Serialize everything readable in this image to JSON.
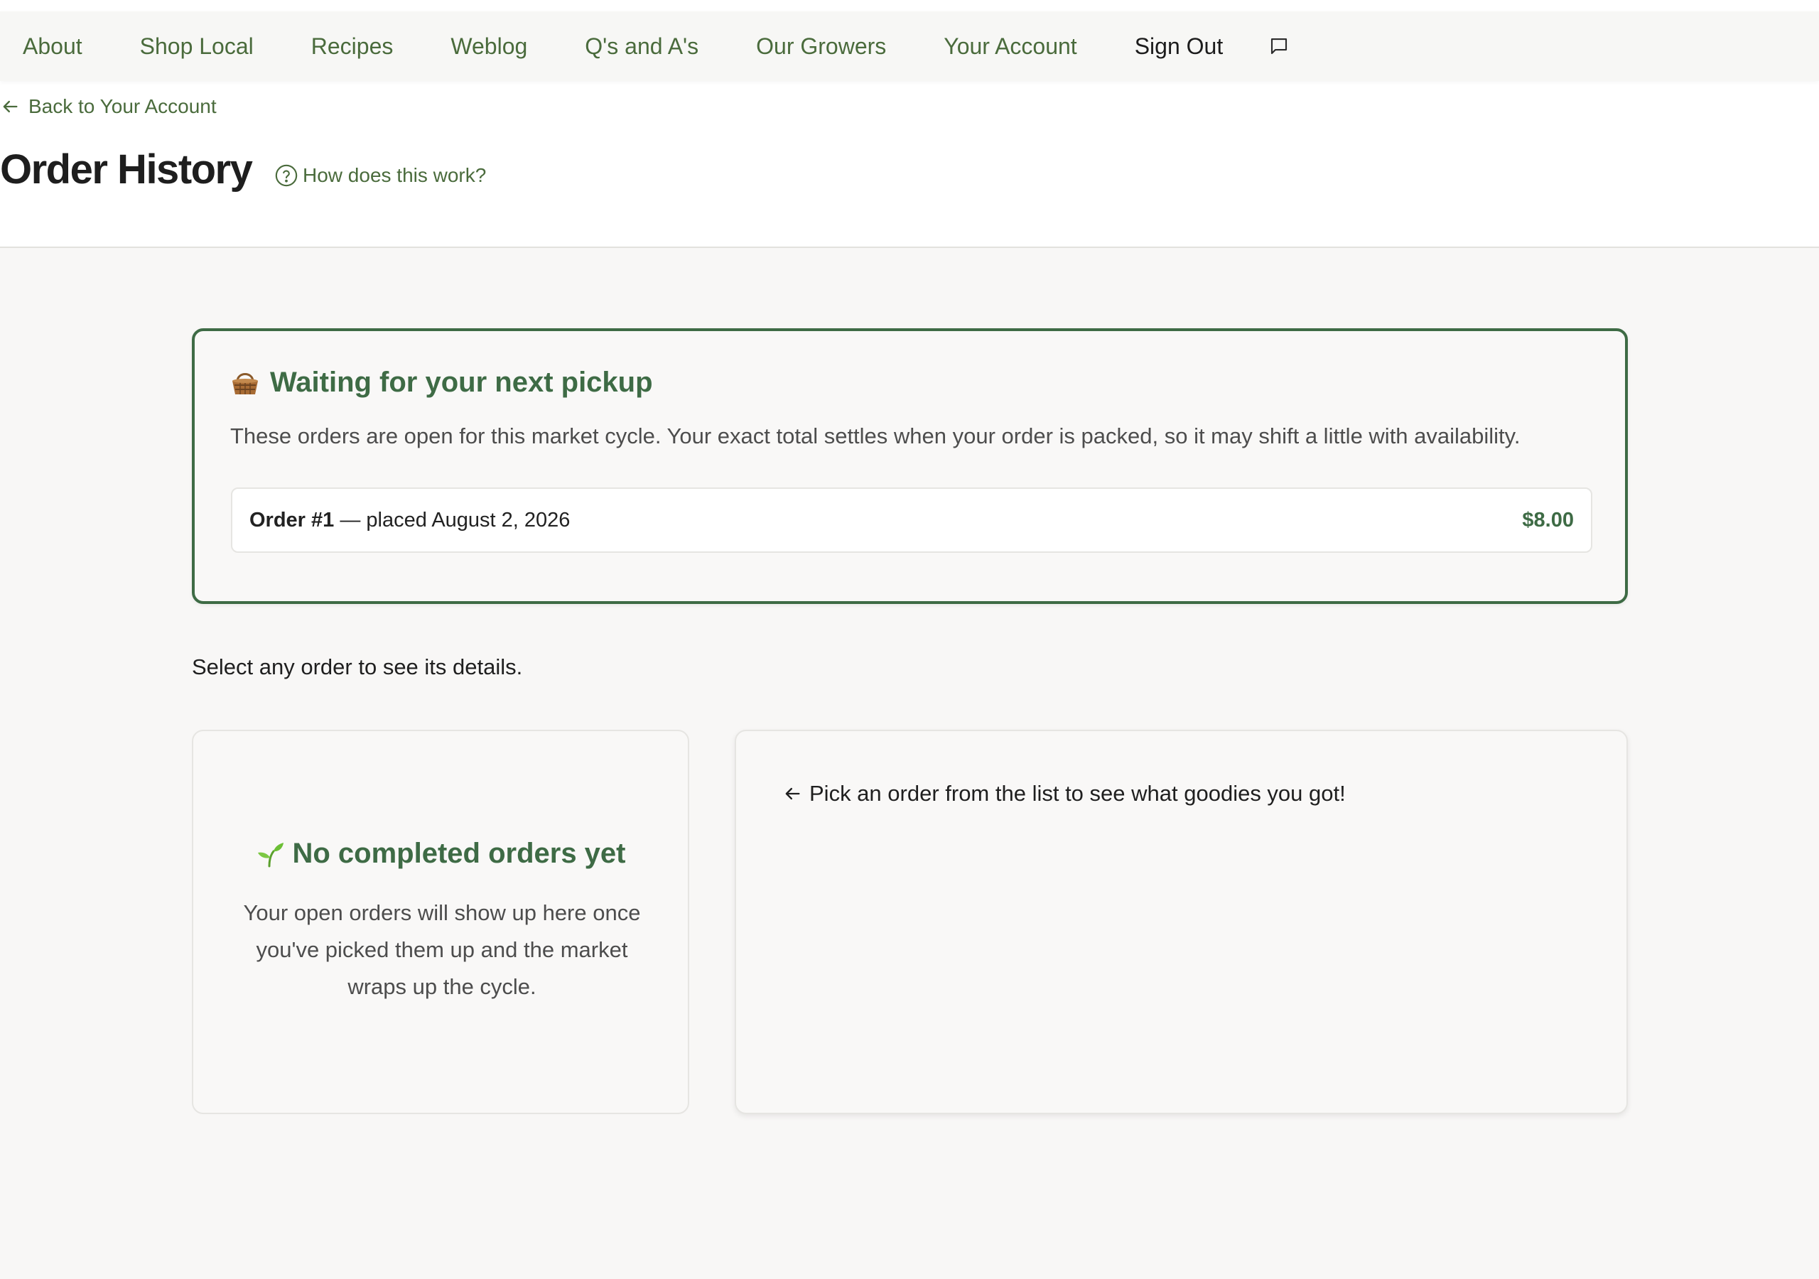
{
  "nav": {
    "items": [
      {
        "label": "About"
      },
      {
        "label": "Shop Local"
      },
      {
        "label": "Recipes"
      },
      {
        "label": "Weblog"
      },
      {
        "label": "Q's and A's"
      },
      {
        "label": "Our Growers"
      },
      {
        "label": "Your Account"
      }
    ],
    "sign_out": "Sign Out",
    "chat_icon": "chat-bubble-icon"
  },
  "header": {
    "back_label": "Back to Your Account",
    "back_icon": "arrow-left-icon",
    "title": "Order History",
    "help_label": "How does this work?",
    "help_icon": "question-circle-icon"
  },
  "pickup": {
    "icon": "basket-icon",
    "title": "Waiting for your next pickup",
    "description": "These orders are open for this market cycle. Your exact total settles when your order is packed, so it may shift a little with availability.",
    "orders": [
      {
        "number": "Order #1",
        "placed": " — placed August 2, 2026",
        "total": "$8.00"
      }
    ]
  },
  "select_hint": "Select any order to see its details.",
  "completed": {
    "icon": "sprout-icon",
    "empty_title": "No completed orders yet",
    "empty_description": "Your open orders will show up here once you've picked them up and the market wraps up the cycle."
  },
  "detail": {
    "hint_icon": "arrow-left-icon",
    "hint": "Pick an order from the list to see what goodies you got!"
  },
  "colors": {
    "accent_green": "#3e6b45",
    "nav_green": "#4a6b3c",
    "page_background": "#f8f7f6"
  }
}
